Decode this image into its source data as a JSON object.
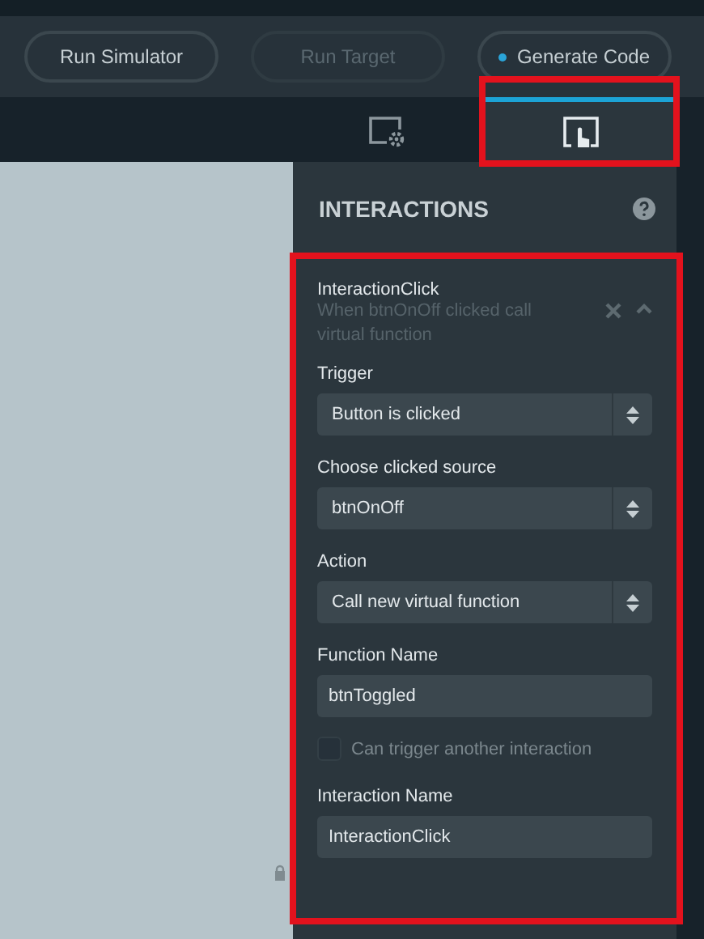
{
  "toolbar": {
    "buttons": [
      {
        "label": "Run Simulator",
        "disabled": false,
        "indicator": false
      },
      {
        "label": "Run Target",
        "disabled": true,
        "indicator": false
      },
      {
        "label": "Generate Code",
        "disabled": false,
        "indicator": true
      }
    ]
  },
  "tabs": [
    {
      "kind": "settings",
      "selected": false
    },
    {
      "kind": "interactions",
      "selected": true
    }
  ],
  "panel": {
    "title": "INTERACTIONS",
    "interaction": {
      "name": "InteractionClick",
      "description": "When btnOnOff clicked call virtual function",
      "expanded": true,
      "fields": [
        {
          "kind": "select",
          "label": "Trigger",
          "value": "Button is clicked"
        },
        {
          "kind": "select",
          "label": "Choose clicked source",
          "value": "btnOnOff"
        },
        {
          "kind": "select",
          "label": "Action",
          "value": "Call new virtual function"
        },
        {
          "kind": "text",
          "label": "Function Name",
          "value": "btnToggled"
        },
        {
          "kind": "checkbox",
          "label": "Can trigger another interaction",
          "checked": false
        },
        {
          "kind": "text",
          "label": "Interaction Name",
          "value": "InteractionClick"
        }
      ]
    }
  }
}
